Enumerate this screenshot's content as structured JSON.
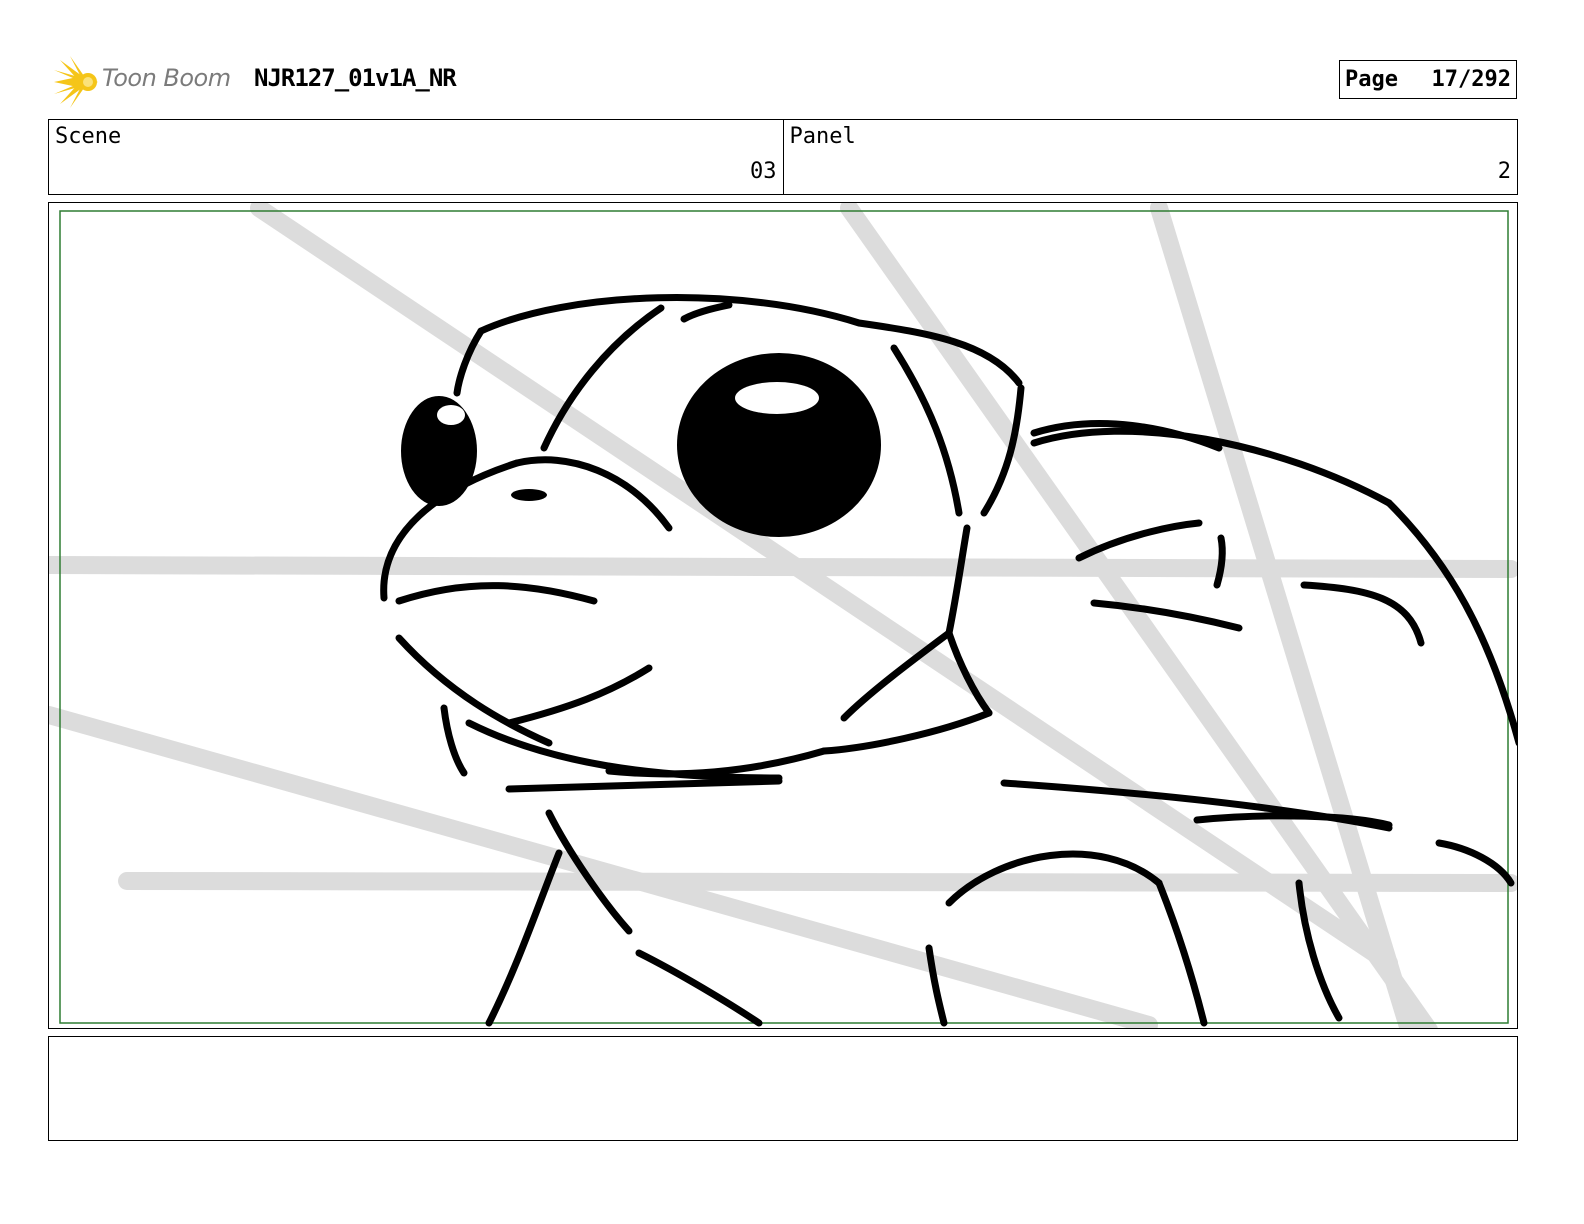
{
  "header": {
    "logo_text": "Toon Boom",
    "document_title": "NJR127_01v1A_NR",
    "page_label": "Page",
    "page_number": "17/292"
  },
  "info": {
    "scene_label": "Scene",
    "scene_value": "03",
    "panel_label": "Panel",
    "panel_value": "2"
  },
  "panel": {
    "image_icon": "sketch-turtle-icon",
    "safe_frame_color": "#2e7d32",
    "sketch_color": "#000000",
    "guide_line_color": "#dcdcdc"
  },
  "notes": {
    "text": ""
  }
}
